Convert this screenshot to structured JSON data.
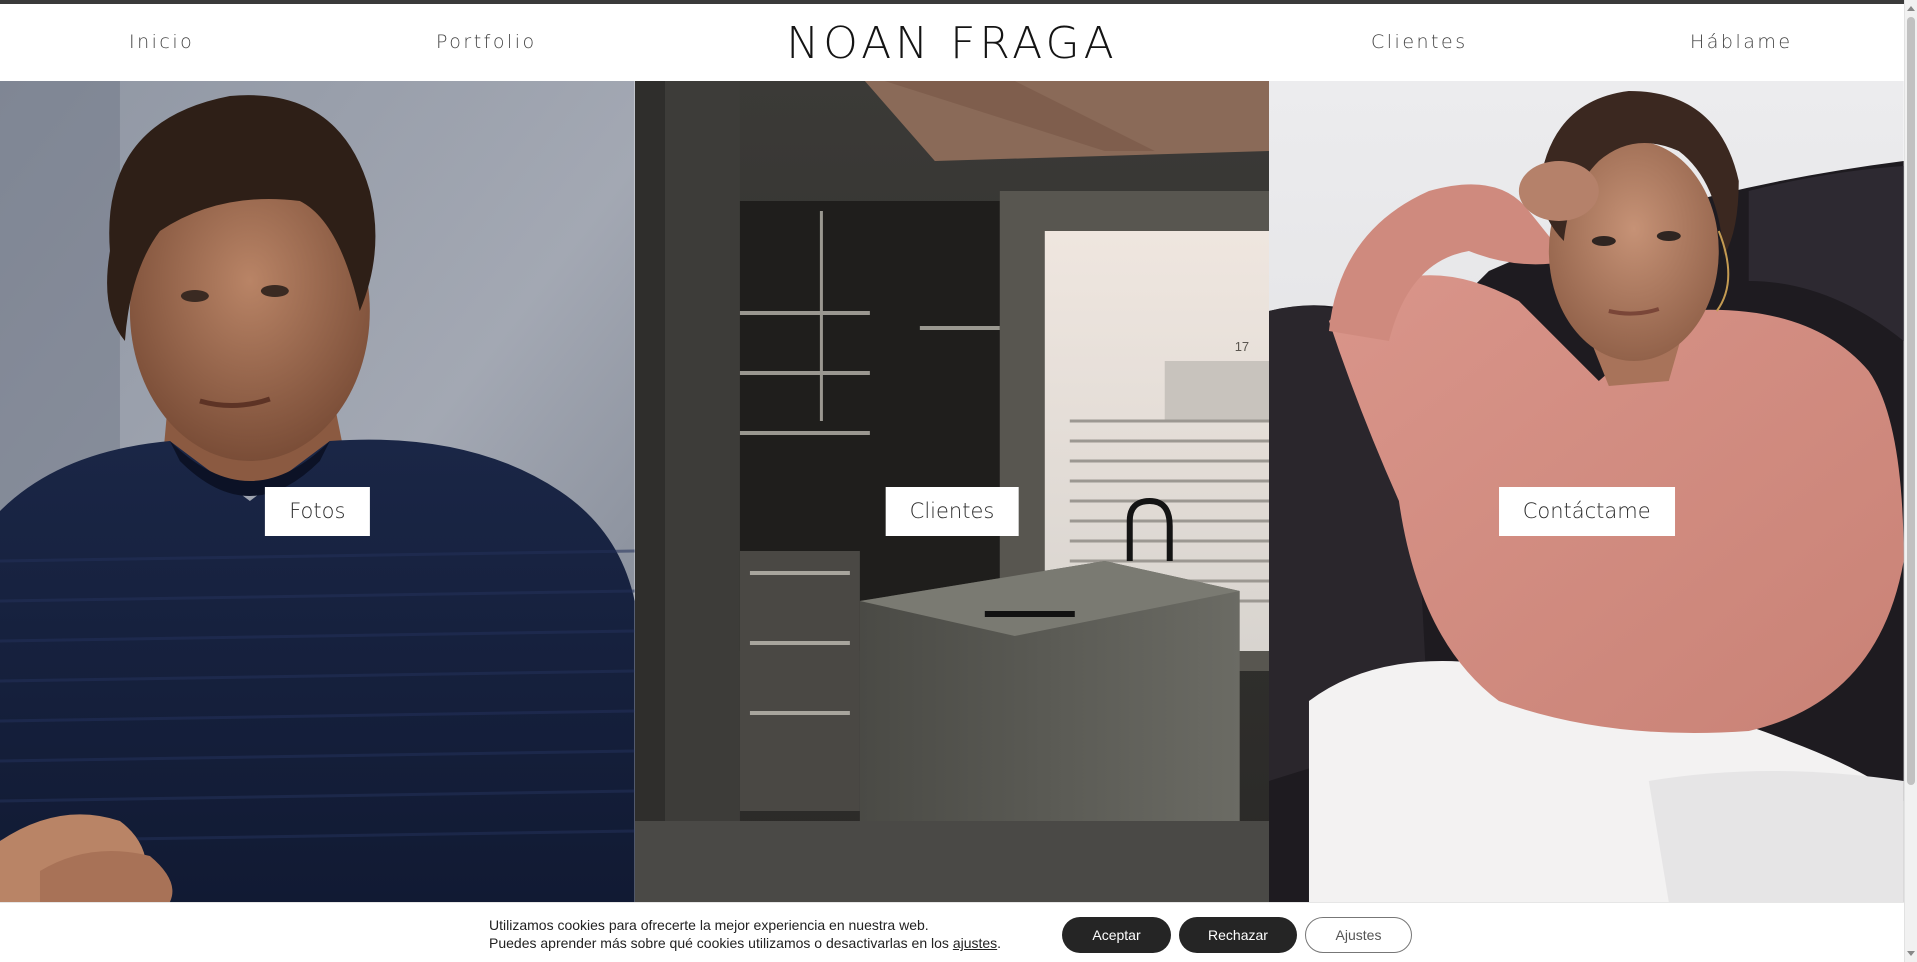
{
  "header": {
    "logo": "NOAN FRAGA",
    "nav": [
      {
        "label": "Inicio"
      },
      {
        "label": "Portfolio"
      },
      {
        "label": "Clientes"
      },
      {
        "label": "Háblame"
      }
    ]
  },
  "hero": {
    "panels": [
      {
        "label": "Fotos",
        "image": "portrait-man-navy-sweater"
      },
      {
        "label": "Clientes",
        "image": "concrete-kitchen-interior"
      },
      {
        "label": "Contáctame",
        "image": "portrait-woman-pink-sweater"
      }
    ],
    "room_number": "17"
  },
  "cookie_bar": {
    "line1": "Utilizamos cookies para ofrecerte la mejor experiencia en nuestra web.",
    "line2_prefix": "Puedes aprender más sobre qué cookies utilizamos o desactivarlas en los ",
    "link_label": "ajustes",
    "line2_suffix": ".",
    "accept_label": "Aceptar",
    "reject_label": "Rechazar",
    "settings_label": "Ajustes"
  },
  "colors": {
    "nav_text": "#444444",
    "logo_text": "#141414",
    "button_dark": "#252525",
    "label_bg": "#ffffff"
  }
}
